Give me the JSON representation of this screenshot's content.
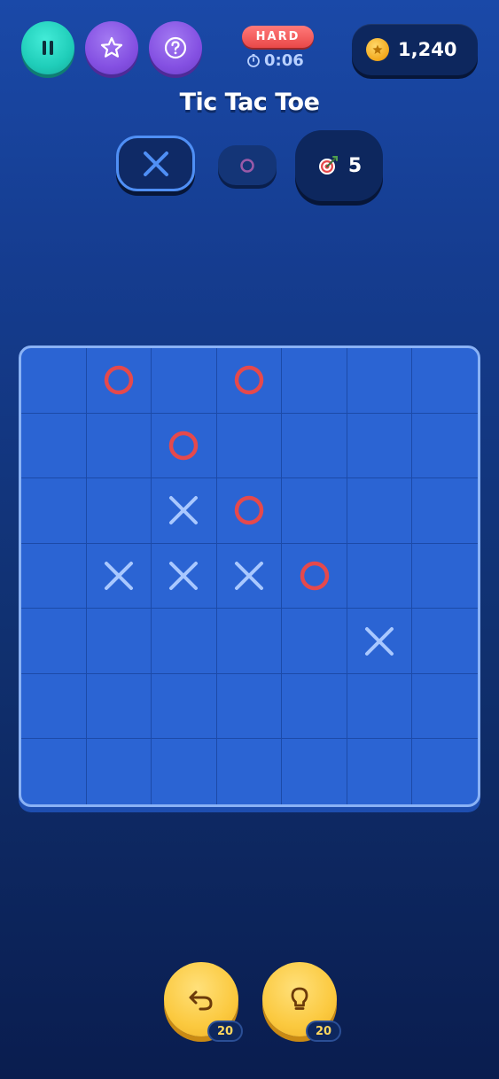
{
  "header": {
    "difficulty": "HARD",
    "timer": "0:06",
    "coins": "1,240",
    "title": "Tic Tac Toe"
  },
  "players": {
    "x_label": "X",
    "o_label": "O",
    "target_count": "5",
    "active": "x"
  },
  "icons": {
    "pause": "pause-icon",
    "favorite": "star-icon",
    "help": "help-icon",
    "timer": "stopwatch-icon",
    "coin": "coin-icon",
    "target": "target-icon",
    "undo": "undo-icon",
    "hint": "lightbulb-icon"
  },
  "colors": {
    "x_mark": "#a9c8ff",
    "o_mark": "#e5494c",
    "board": "#2b64d3",
    "accent_teal": "#1fcdb9",
    "accent_purple": "#8450e2",
    "powerup": "#fbc93f"
  },
  "board": {
    "size": 7,
    "cells": [
      [
        "",
        "O",
        "",
        "O",
        "",
        "",
        ""
      ],
      [
        "",
        "",
        "O",
        "",
        "",
        "",
        ""
      ],
      [
        "",
        "",
        "X",
        "O",
        "",
        "",
        ""
      ],
      [
        "",
        "X",
        "X",
        "X",
        "O",
        "",
        ""
      ],
      [
        "",
        "",
        "",
        "",
        "",
        "X",
        ""
      ],
      [
        "",
        "",
        "",
        "",
        "",
        "",
        ""
      ],
      [
        "",
        "",
        "",
        "",
        "",
        "",
        ""
      ]
    ]
  },
  "powerups": {
    "undo_count": "20",
    "hint_count": "20"
  }
}
